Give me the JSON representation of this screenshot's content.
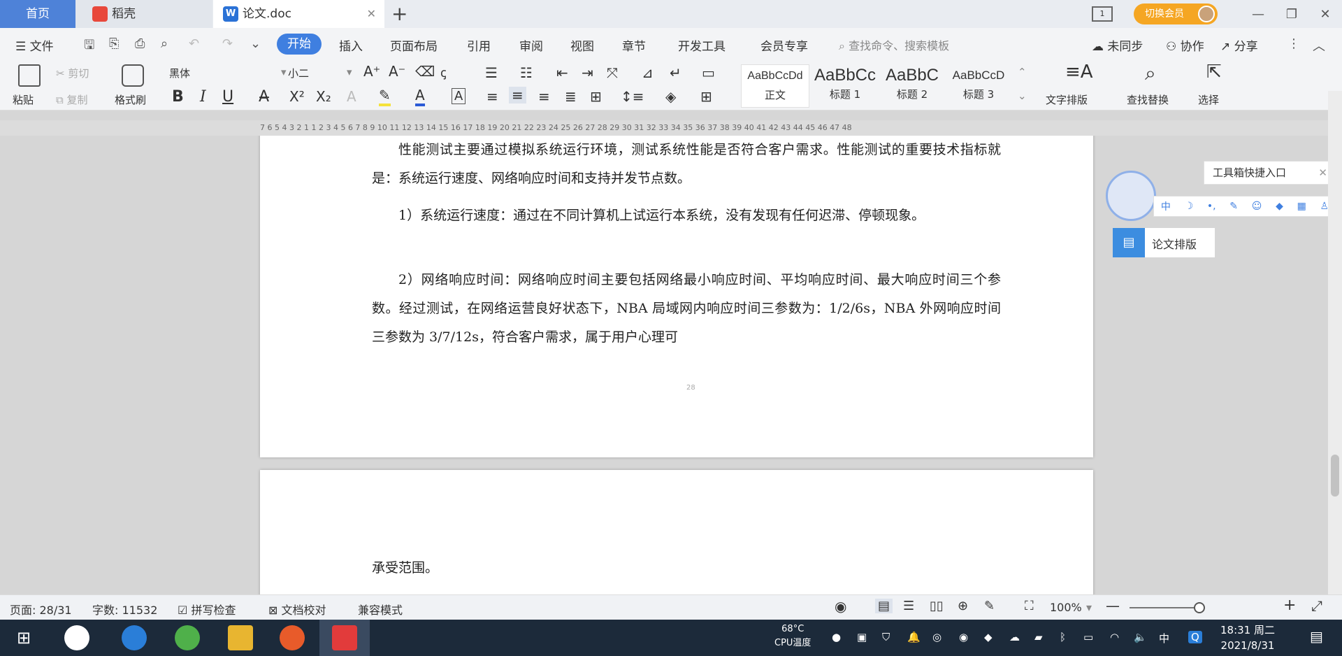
{
  "tabs": {
    "home": "首页",
    "daoke": "稻壳",
    "doc": "论文.doc",
    "vip": "切换会员"
  },
  "menu": {
    "file": "文件",
    "items": [
      "开始",
      "插入",
      "页面布局",
      "引用",
      "审阅",
      "视图",
      "章节",
      "开发工具",
      "会员专享"
    ],
    "search_placeholder": "查找命令、搜索模板",
    "sync": "未同步",
    "collab": "协作",
    "share": "分享"
  },
  "ribbon": {
    "paste": "粘贴",
    "cut": "剪切",
    "copy": "复制",
    "format_painter": "格式刷",
    "font_name": "黑体",
    "font_size": "小二",
    "styles": [
      {
        "sample": "AaBbCcDd",
        "name": "正文"
      },
      {
        "sample": "AaBbCc",
        "name": "标题 1"
      },
      {
        "sample": "AaBbC",
        "name": "标题 2"
      },
      {
        "sample": "AaBbCcD",
        "name": "标题 3"
      }
    ],
    "text_layout": "文字排版",
    "find_replace": "查找替换",
    "select": "选择"
  },
  "ruler": "7 6 5 4 3 2 1  1 2 3 4 5 6 7 8 9 10 11 12 13 14 15 16 17 18 19 20 21 22 23 24 25 26 27 28 29 30 31 32 33 34 35 36 37 38 39 40 41 42 43 44 45 46 47 48",
  "document": {
    "p1": "性能测试主要通过模拟系统运行环境，测试系统性能是否符合客户需求。性能测试的重要技术指标就是：系统运行速度、网络响应时间和支持并发节点数。",
    "p2": "1）系统运行速度：通过在不同计算机上试运行本系统，没有发现有任何迟滞、停顿现象。",
    "p3": "2）网络响应时间：网络响应时间主要包括网络最小响应时间、平均响应时间、最大响应时间三个参数。经过测试，在网络运营良好状态下，NBA 局域网内响应时间三参数为：1/2/6s，NBA 外网响应时间三参数为 3/7/12s，符合客户需求，属于用户心理可",
    "page_num": "28",
    "p4": "承受范围。"
  },
  "side_panel": {
    "toolbox": "工具箱快捷入口",
    "mini_label": "中",
    "thesis_layout": "论文排版"
  },
  "status": {
    "page": "页面: 28/31",
    "words": "字数: 11532",
    "spell": "拼写检查",
    "proof": "文档校对",
    "compat": "兼容模式",
    "zoom": "100%"
  },
  "taskbar": {
    "cpu_temp": "68°C",
    "cpu_label": "CPU温度",
    "ime": "中",
    "time": "18:31 周二",
    "date": "2021/8/31"
  },
  "colors": {
    "accent": "#3f7fe0",
    "home_tab": "#4e82d8",
    "vip": "#f5a623"
  }
}
